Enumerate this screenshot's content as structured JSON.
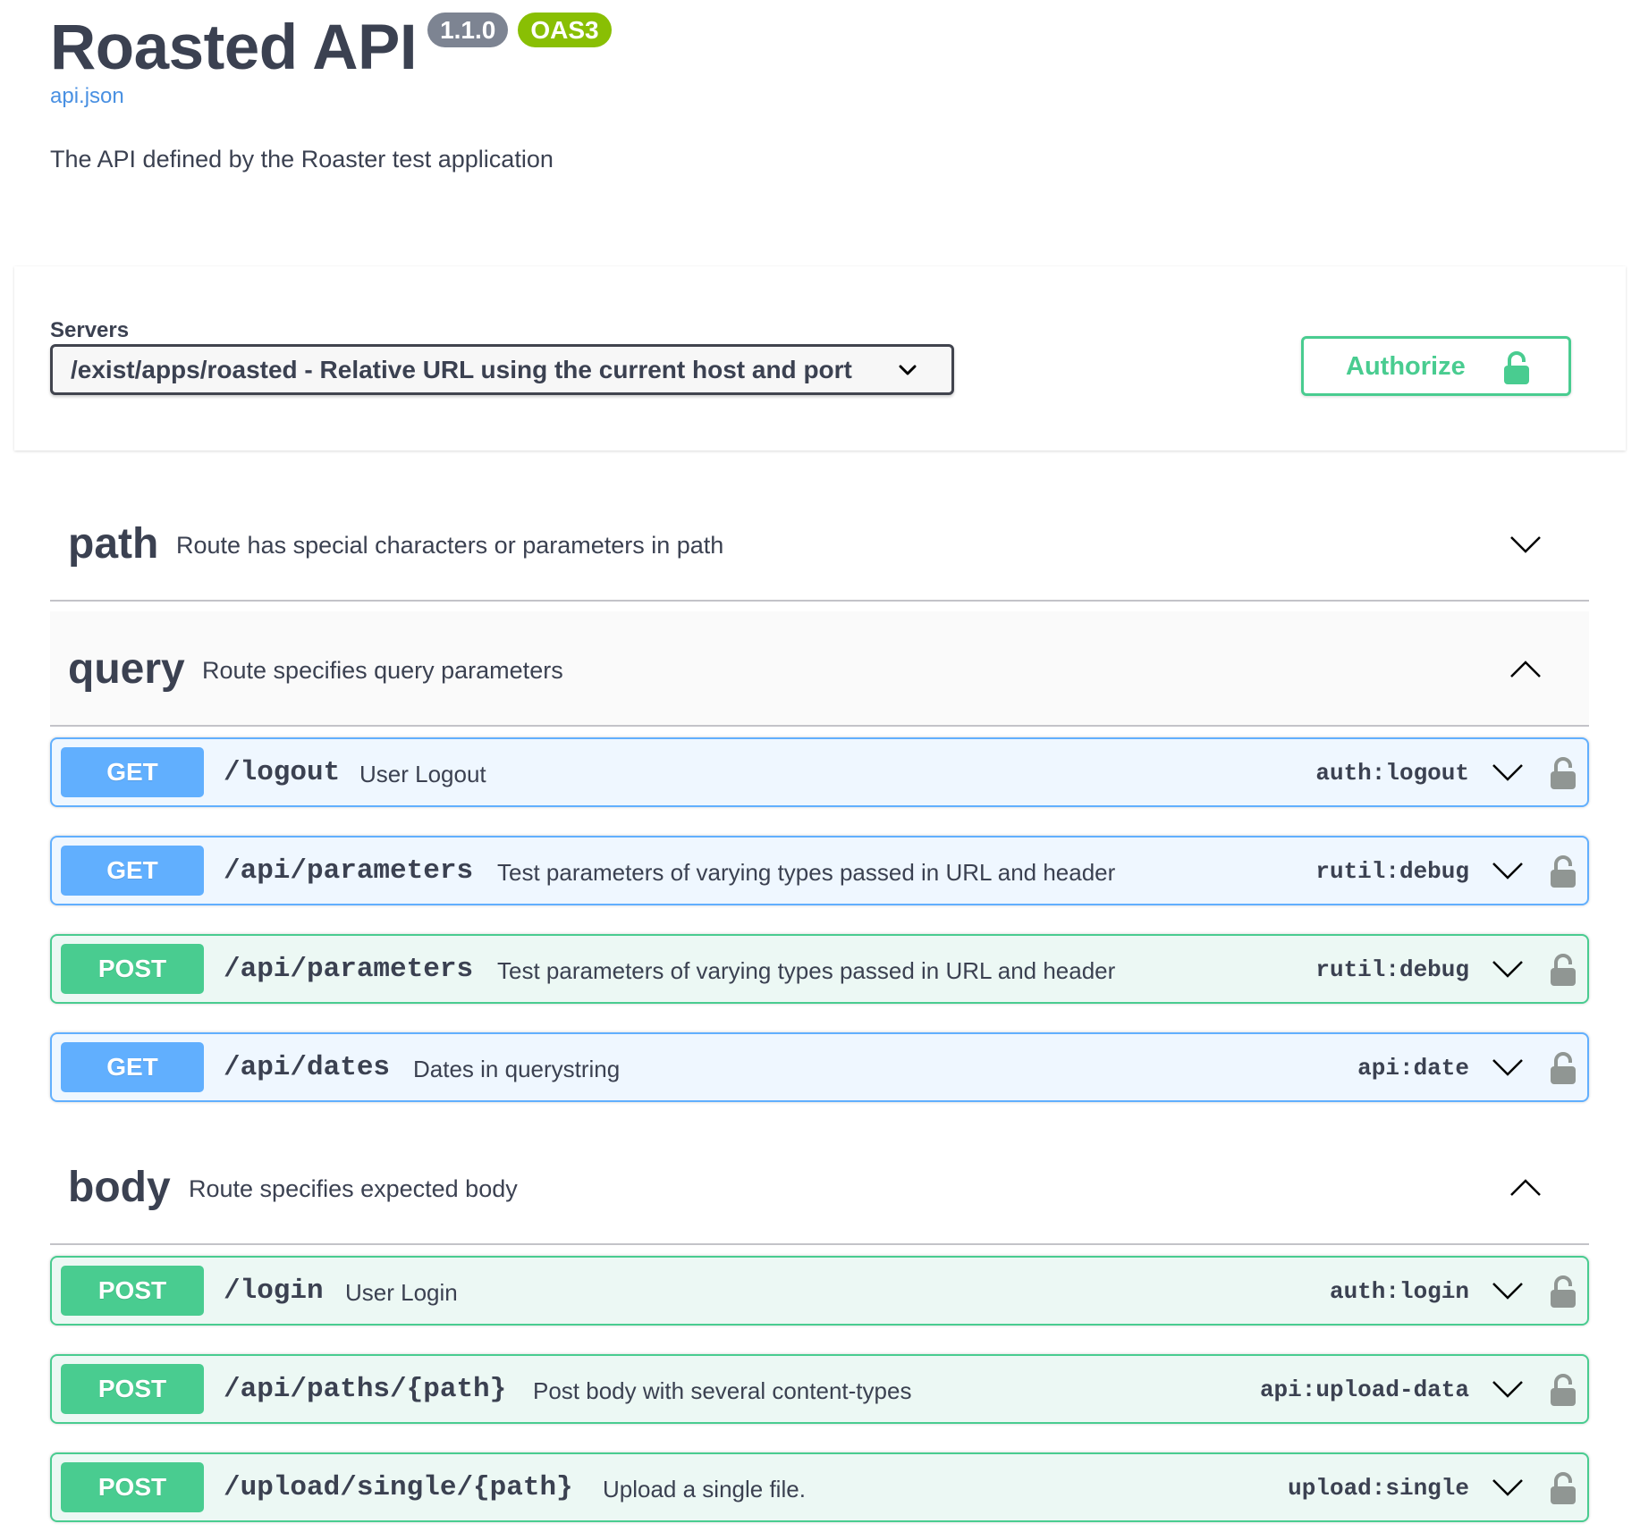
{
  "info": {
    "title": "Roasted API",
    "version": "1.1.0",
    "oas_badge": "OAS3",
    "spec_link": "api.json",
    "description": "The API defined by the Roaster test application"
  },
  "servers": {
    "label": "Servers",
    "selected": "/exist/apps/roasted - Relative URL using the current host and port"
  },
  "authorize": {
    "label": "Authorize",
    "icon": "unlocked-padlock-icon"
  },
  "colors": {
    "get": "#61affe",
    "post": "#49cc90",
    "version_badge": "#7d8492",
    "oas_badge": "#89bf04",
    "link": "#4990e2",
    "text": "#3b4151",
    "lock": "#909693"
  },
  "tags": [
    {
      "name": "path",
      "description": "Route has special characters or parameters in path",
      "expanded": false,
      "operations": []
    },
    {
      "name": "query",
      "description": "Route specifies query parameters",
      "expanded": true,
      "operations": [
        {
          "method": "GET",
          "path": "/logout",
          "summary": "User Logout",
          "operation_id": "auth:logout"
        },
        {
          "method": "GET",
          "path": "/api/parameters",
          "summary": "Test parameters of varying types passed in URL and header",
          "operation_id": "rutil:debug"
        },
        {
          "method": "POST",
          "path": "/api/parameters",
          "summary": "Test parameters of varying types passed in URL and header",
          "operation_id": "rutil:debug"
        },
        {
          "method": "GET",
          "path": "/api/dates",
          "summary": "Dates in querystring",
          "operation_id": "api:date"
        }
      ]
    },
    {
      "name": "body",
      "description": "Route specifies expected body",
      "expanded": true,
      "operations": [
        {
          "method": "POST",
          "path": "/login",
          "summary": "User Login",
          "operation_id": "auth:login"
        },
        {
          "method": "POST",
          "path": "/api/paths/{path}",
          "summary": "Post body with several content-types",
          "operation_id": "api:upload-data"
        },
        {
          "method": "POST",
          "path": "/upload/single/{path}",
          "summary": "Upload a single file.",
          "operation_id": "upload:single"
        }
      ]
    }
  ]
}
